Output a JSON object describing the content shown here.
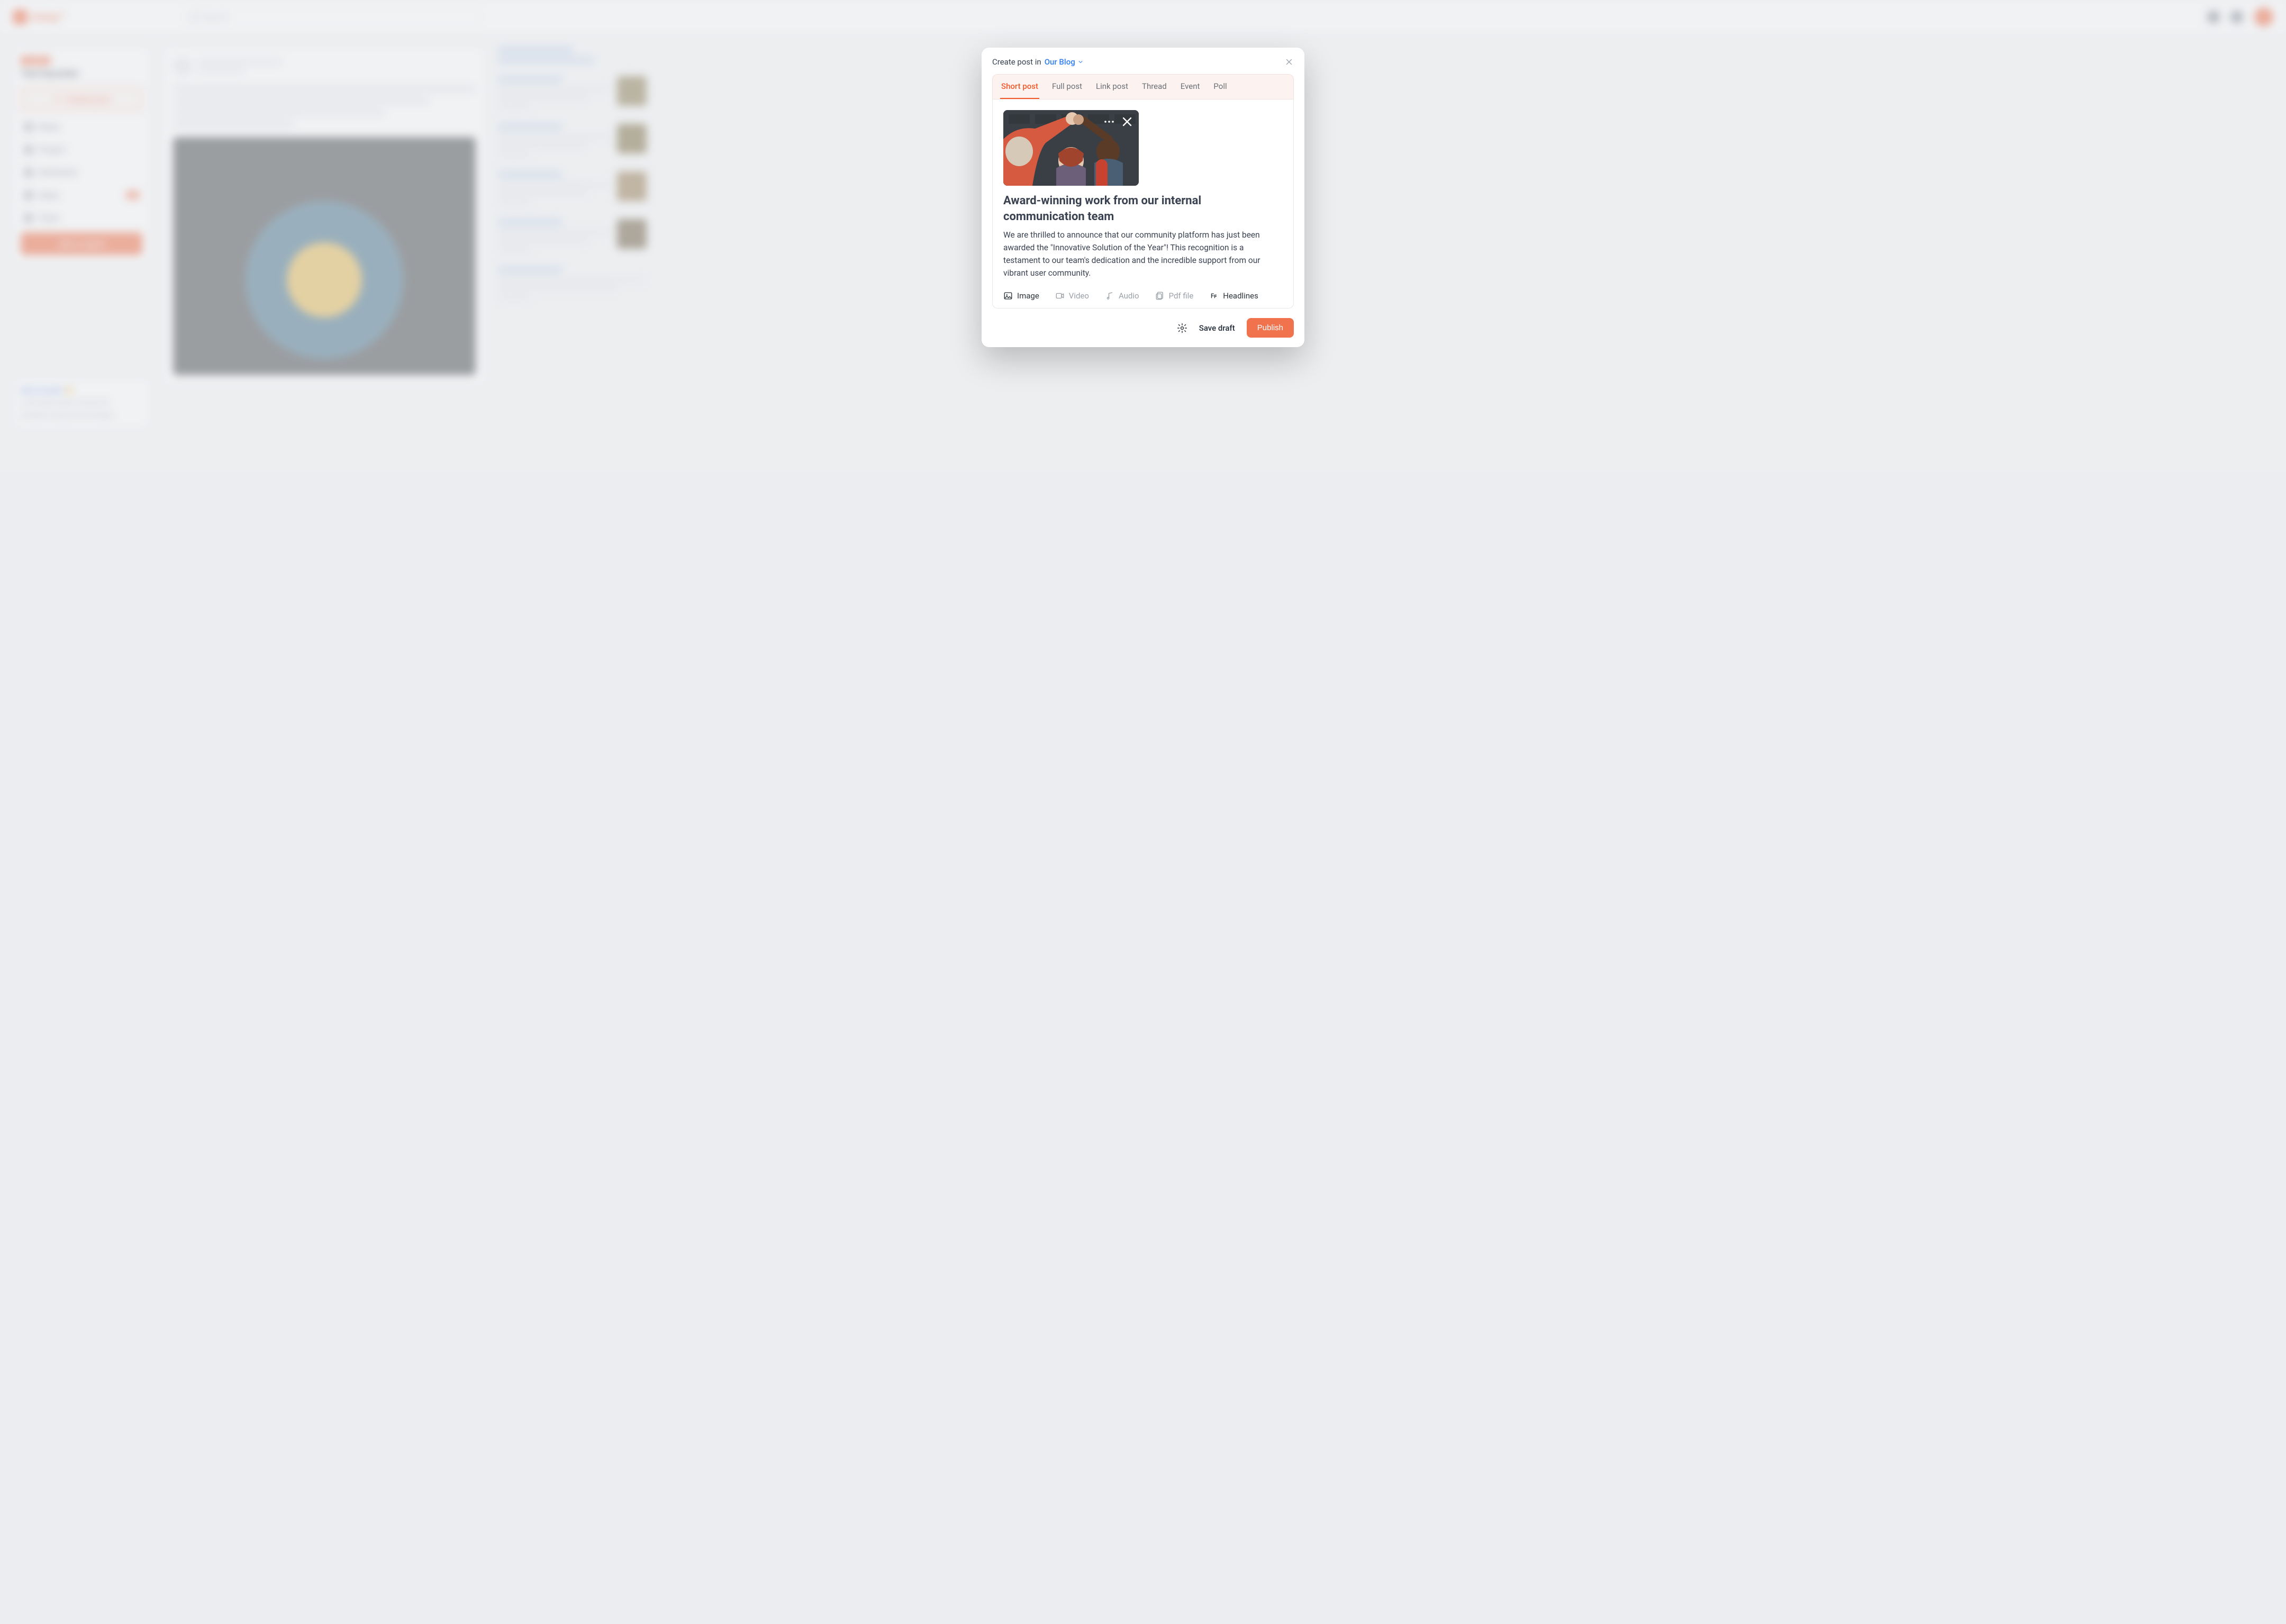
{
  "modal": {
    "create_in_label": "Create post in",
    "blog_name": "Our Blog",
    "tabs": {
      "short_post": "Short post",
      "full_post": "Full post",
      "link_post": "Link post",
      "thread": "Thread",
      "event": "Event",
      "poll": "Poll"
    },
    "active_tab": "short_post",
    "image_alt": "team-high-five-photo",
    "post_title": "Award-winning work from our internal communication team",
    "post_body": "We are thrilled to announce that our community platform has just been awarded the \"Innovative Solution of the Year\"! This recognition is a testament to our team's dedication and the incredible support from our vibrant user community.",
    "attachments": {
      "image": "Image",
      "video": "Video",
      "audio": "Audio",
      "pdf": "Pdf file",
      "headlines": "Headlines"
    },
    "footer": {
      "save_draft": "Save draft",
      "publish": "Publish"
    }
  },
  "background": {
    "brand": "tchop™",
    "search_placeholder": "Search",
    "sidebar": {
      "badge_label": "COMMS",
      "title": "Test launcher",
      "create_post": "Create post",
      "items": [
        {
          "label": "News"
        },
        {
          "label": "Project"
        },
        {
          "label": "Sentiment"
        },
        {
          "label": "Ideas",
          "badge": "12"
        },
        {
          "label": "Team"
        }
      ],
      "join_button": "Join a space",
      "promo_title": "Get in touch! 👋",
      "promo_line1": "Lorem ipsum dolor sit amet elit",
      "promo_line2": "sed diam nonumy eirmod tempor"
    },
    "rightcol": {
      "header": "Latest updates",
      "link": "See all recent posts"
    }
  },
  "colors": {
    "accent": "#f1592a",
    "link": "#2f7ef6"
  }
}
